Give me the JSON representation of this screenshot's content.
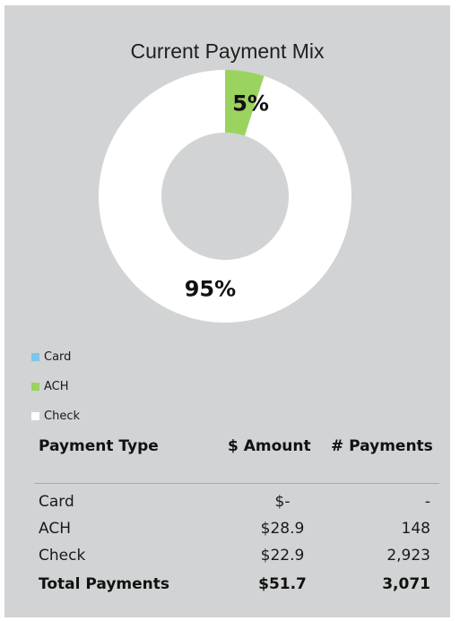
{
  "chart_data": {
    "type": "pie",
    "title": "Current Payment Mix",
    "donut": true,
    "legend_position": "bottom-left",
    "series": [
      {
        "name": "Card",
        "value": 0,
        "label": "",
        "color": "#7cc6e8"
      },
      {
        "name": "ACH",
        "value": 5,
        "label": "5%",
        "color": "#9bd35f"
      },
      {
        "name": "Check",
        "value": 95,
        "label": "95%",
        "color": "#ffffff"
      }
    ]
  },
  "table": {
    "headers": {
      "type": "Payment Type",
      "amount": "$ Amount",
      "count": "# Payments"
    },
    "rows": [
      {
        "type": "Card",
        "amount": "$-",
        "count": "-"
      },
      {
        "type": "ACH",
        "amount": "$28.9",
        "count": "148"
      },
      {
        "type": "Check",
        "amount": "$22.9",
        "count": "2,923"
      }
    ],
    "total": {
      "type": "Total Payments",
      "amount": "$51.7",
      "count": "3,071"
    }
  },
  "colors": {
    "background": "#d1d3d4",
    "divider": "#a7a9ab"
  }
}
